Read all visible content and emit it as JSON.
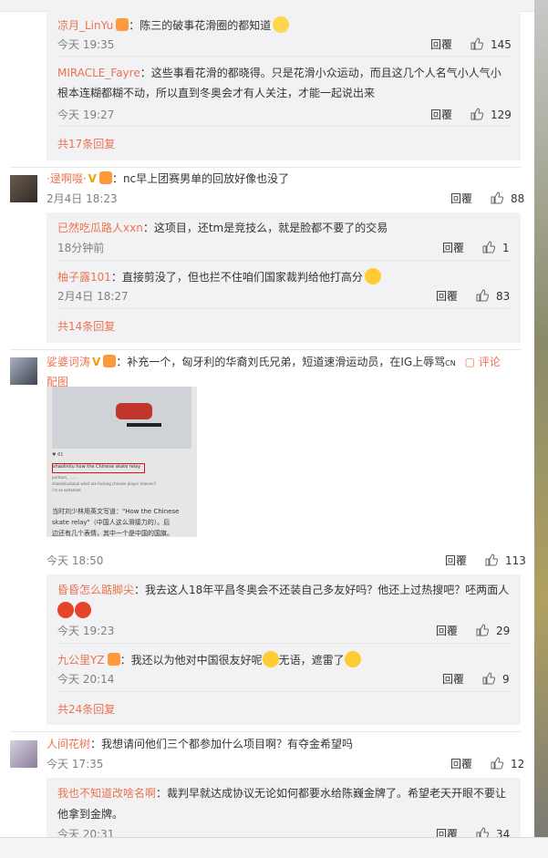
{
  "thread1": {
    "replies": [
      {
        "name": "凉月_LinYu",
        "text": "：陈三的破事花滑圈的都知道",
        "time": "今天 19:35",
        "reply_label": "回覆",
        "likes": "145"
      },
      {
        "name": "MIRACLE_Fayre",
        "text_line1": "：这些事看花滑的都晓得。只是花滑小众运动，而且这几个人名气小人气小",
        "text_line2": "根本连糊都糊不动，所以直到冬奥会才有人关注，才能一起说出来",
        "time": "今天 19:27",
        "reply_label": "回覆",
        "likes": "129"
      }
    ],
    "more": "共17条回复"
  },
  "comment2": {
    "name": "·逯啊啜·",
    "text": "：nc早上团赛男单的回放好像也没了",
    "time": "2月4日 18:23",
    "reply_label": "回覆",
    "likes": "88",
    "replies": [
      {
        "name": "已然吃瓜路人xxn",
        "text": "：这项目，还tm是竞技么，就是脸都不要了的交易",
        "time": "18分钟前",
        "reply_label": "回覆",
        "likes": "1"
      },
      {
        "name": "柚子露101",
        "text": "：直接剪没了，但也拦不住咱们国家裁判给他打高分",
        "time": "2月4日 18:27",
        "reply_label": "回覆",
        "likes": "83"
      }
    ],
    "more": "共14条回复"
  },
  "comment3": {
    "name": "娑婆诃涛",
    "text": "：补充一个，匈牙利的华裔刘氏兄弟，短道速滑运动员，在IG上辱骂",
    "text_suffix": "CN",
    "comment_link": "评论",
    "image_label": "配图",
    "thumb_caption1": "当时刘少林用英文写道：\"How the Chinese",
    "thumb_caption2": "skate relay\"（中国人这么滑接力的）。后",
    "thumb_caption3": "边还有几个表情，其中一个是中国的国旗。",
    "thumb_post": "shaolinliu how the Chinese skate relay",
    "thumb_reply1": "parkson_ ……",
    "thumb_reply2": "shaolinliuduluk what are fucking chinese player manner?",
    "thumb_reply3": "i'm so ashamed",
    "time": "今天 18:50",
    "reply_label": "回覆",
    "likes": "113",
    "replies": [
      {
        "name": "昏昏怎么踮脚尖",
        "text": "：我去这人18年平昌冬奥会不还装自己多友好吗？他还上过热搜吧？呸两面人",
        "time": "今天 19:23",
        "reply_label": "回覆",
        "likes": "29"
      },
      {
        "name": "九公里YZ",
        "text": "：我还以为他对中国很友好呢",
        "text2": "无语，遮雷了",
        "time": "今天 20:14",
        "reply_label": "回覆",
        "likes": "9"
      }
    ],
    "more": "共24条回复"
  },
  "comment4": {
    "name": "人间花树",
    "text": "：我想请问他们三个都参加什么项目啊？有夺金希望吗",
    "time": "今天 17:35",
    "reply_label": "回覆",
    "likes": "12",
    "replies": [
      {
        "name": "我也不知道改啥名啊",
        "text_line1": "：裁判早就达成协议无论如何都要水给陈巍金牌了。希望老天开眼不要让",
        "text_line2": "他拿到金牌。",
        "time": "今天 20:31",
        "reply_label": "回覆",
        "likes": "34"
      }
    ]
  },
  "colors": {
    "name": "#eb7350",
    "sub_bg": "#f2f2f5",
    "time": "#808080"
  }
}
